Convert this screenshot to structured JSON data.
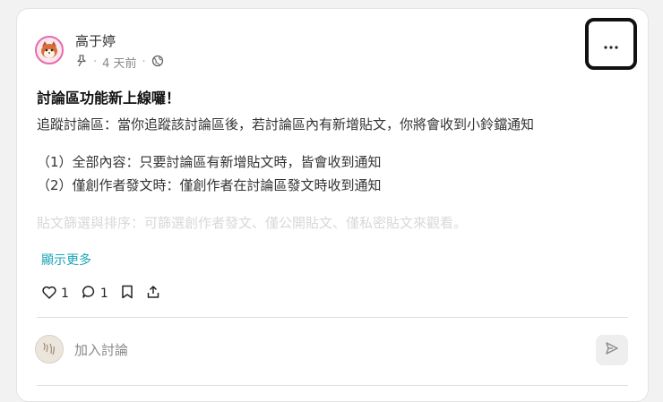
{
  "post": {
    "author": "高于婷",
    "time": "4 天前",
    "title": "討論區功能新上線囉！",
    "paragraph1": "追蹤討論區：當你追蹤該討論區後，若討論區內有新增貼文，你將會收到小鈴鐺通知",
    "line1": "（1）全部內容：只要討論區有新增貼文時，皆會收到通知",
    "line2": "（2）僅創作者發文時：僅創作者在討論區發文時收到通知",
    "faded_line": "貼文篩選與排序：可篩選創作者發文、僅公開貼文、僅私密貼文來觀看。",
    "show_more": "顯示更多",
    "like_count": "1",
    "comment_count": "1"
  },
  "comment_box": {
    "placeholder": "加入討論"
  },
  "colors": {
    "accent": "#1aa3b8",
    "avatar_border": "#e86aa6"
  }
}
